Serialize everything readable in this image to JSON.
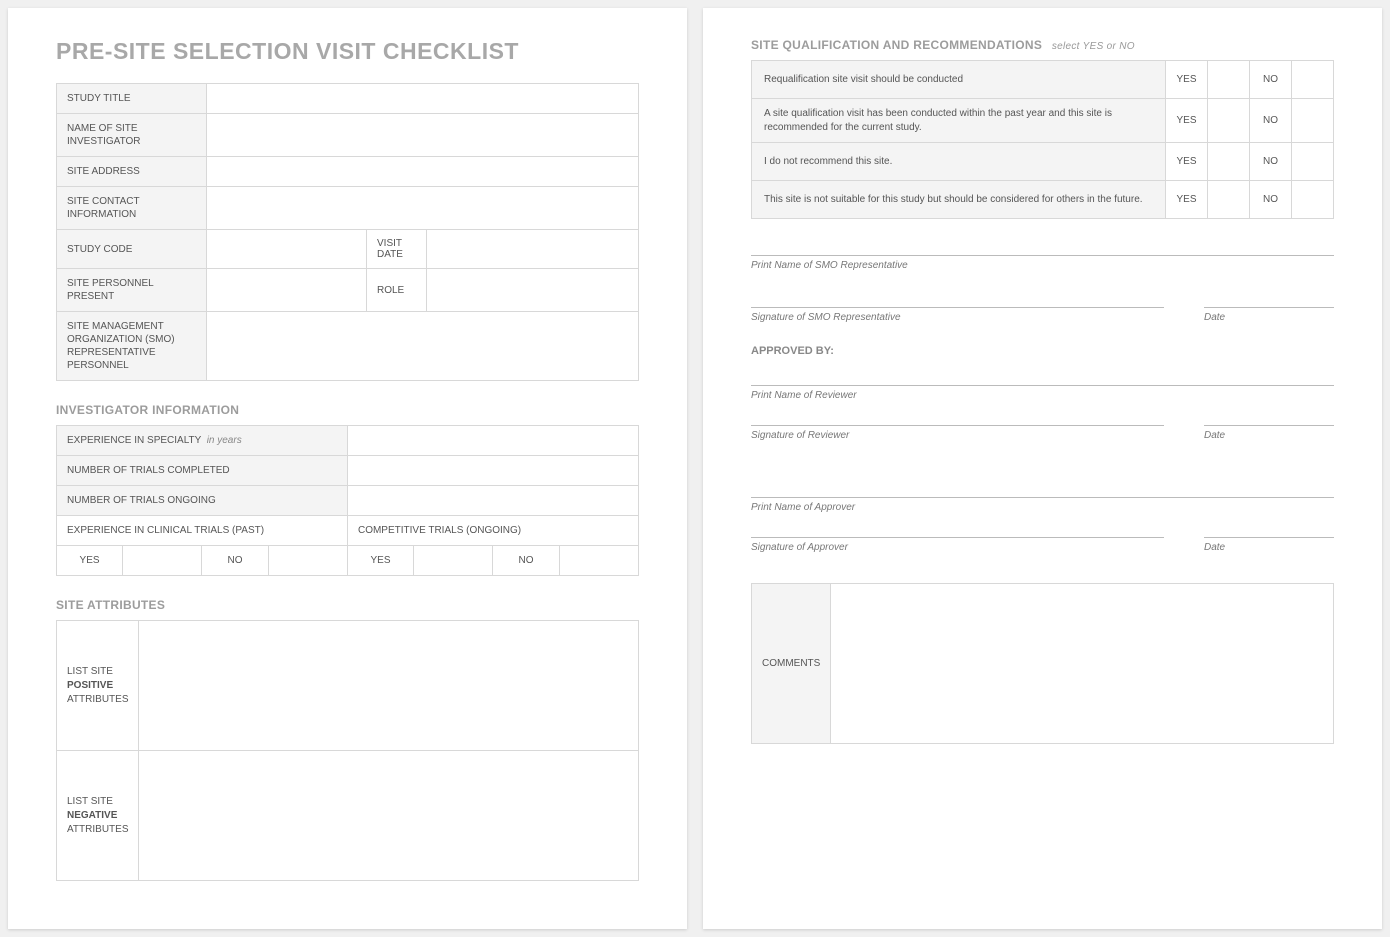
{
  "title": "PRE-SITE SELECTION VISIT CHECKLIST",
  "header_fields": {
    "study_title": "STUDY TITLE",
    "investigator": "NAME OF SITE INVESTIGATOR",
    "address": "SITE ADDRESS",
    "contact": "SITE CONTACT INFORMATION",
    "study_code": "STUDY CODE",
    "visit_date": "VISIT DATE",
    "personnel": "SITE PERSONNEL PRESENT",
    "role": "ROLE",
    "smo": "SITE MANAGEMENT ORGANIZATION (SMO) REPRESENTATIVE PERSONNEL"
  },
  "investigator": {
    "heading": "INVESTIGATOR INFORMATION",
    "exp_specialty": "EXPERIENCE IN SPECIALTY",
    "exp_specialty_hint": "in years",
    "trials_completed": "NUMBER OF TRIALS COMPLETED",
    "trials_ongoing": "NUMBER OF TRIALS ONGOING",
    "exp_clinical": "EXPERIENCE IN CLINICAL TRIALS (PAST)",
    "competitive": "COMPETITIVE TRIALS (ONGOING)",
    "yes": "YES",
    "no": "NO"
  },
  "attributes": {
    "heading": "SITE ATTRIBUTES",
    "positive_pre": "LIST SITE",
    "positive_bold": "POSITIVE",
    "positive_post": "ATTRIBUTES",
    "negative_pre": "LIST SITE",
    "negative_bold": "NEGATIVE",
    "negative_post": "ATTRIBUTES"
  },
  "qualification": {
    "heading": "SITE QUALIFICATION AND RECOMMENDATIONS",
    "hint": "select YES or NO",
    "rows": [
      "Requalification site visit should be conducted",
      "A site qualification visit has been conducted within the past year and this site is recommended for the current study.",
      "I do not recommend this site.",
      "This site is not suitable for this study but should be considered for others in the future."
    ],
    "yes": "YES",
    "no": "NO"
  },
  "signatures": {
    "smo_print": "Print Name of SMO Representative",
    "smo_sig": "Signature of SMO Representative",
    "approved_by": "APPROVED BY:",
    "reviewer_print": "Print Name of Reviewer",
    "reviewer_sig": "Signature of Reviewer",
    "approver_print": "Print Name of Approver",
    "approver_sig": "Signature of Approver",
    "date": "Date"
  },
  "comments": "COMMENTS"
}
